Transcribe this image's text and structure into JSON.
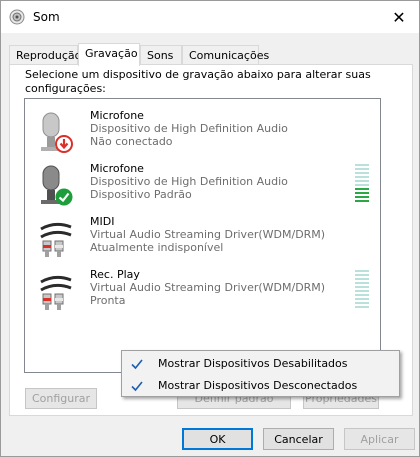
{
  "window": {
    "title": "Som",
    "close_glyph": "✕"
  },
  "tabs": [
    {
      "label": "Reprodução",
      "active": false
    },
    {
      "label": "Gravação",
      "active": true
    },
    {
      "label": "Sons",
      "active": false
    },
    {
      "label": "Comunicações",
      "active": false
    }
  ],
  "instruction": "Selecione um dispositivo de gravação abaixo para alterar suas configurações:",
  "devices": [
    {
      "name": "Microfone",
      "line1": "Dispositivo de High Definition Audio",
      "line2": "Não conectado",
      "icon": "microphone-icon",
      "status": "unplugged",
      "meter": null
    },
    {
      "name": "Microfone",
      "line1": "Dispositivo de High Definition Audio",
      "line2": "Dispositivo Padrão",
      "icon": "microphone-icon",
      "status": "default",
      "meter": {
        "level": 0.4
      }
    },
    {
      "name": "MIDI",
      "line1": "Virtual Audio Streaming Driver(WDM/DRM)",
      "line2": "Atualmente indisponível",
      "icon": "rca-cable-icon",
      "status": "none",
      "meter": null
    },
    {
      "name": "Rec. Play",
      "line1": "Virtual Audio Streaming Driver(WDM/DRM)",
      "line2": "Pronta",
      "icon": "rca-cable-icon",
      "status": "none",
      "meter": {
        "level": 0
      }
    }
  ],
  "context_menu": [
    {
      "label": "Mostrar Dispositivos Desabilitados",
      "checked": true
    },
    {
      "label": "Mostrar Dispositivos Desconectados",
      "checked": true
    }
  ],
  "buttons": {
    "configure": "Configurar",
    "set_default": "Definir padrão",
    "properties": "Propriedades",
    "ok": "OK",
    "cancel": "Cancelar",
    "apply": "Aplicar"
  },
  "colors": {
    "meter_on": "#2aa845",
    "meter_off": "#b9e0db",
    "status_red": "#d9302c",
    "status_green": "#1e9e3a",
    "accent": "#0078d7"
  }
}
